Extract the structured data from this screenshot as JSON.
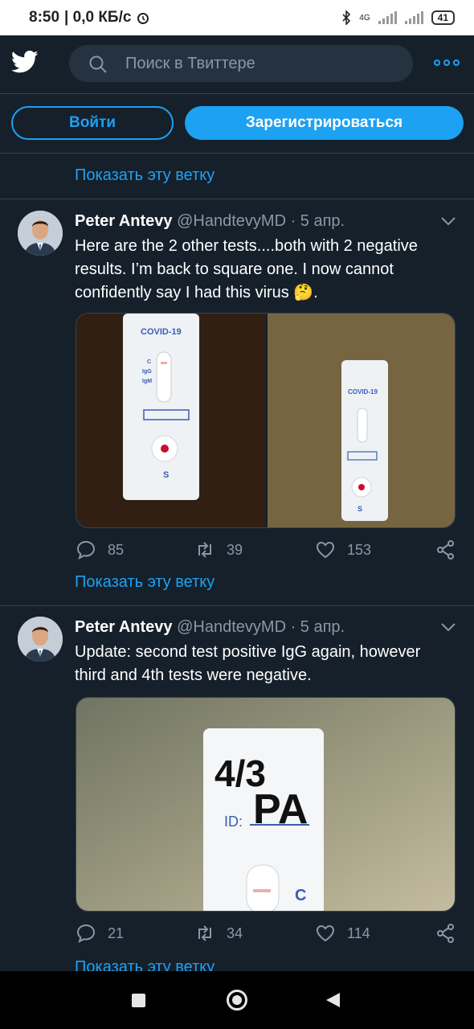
{
  "status_bar": {
    "time": "8:50",
    "speed": "| 0,0 КБ/с",
    "network": "4G",
    "battery": "41"
  },
  "header": {
    "logo_icon": "twitter-bird-icon",
    "search_placeholder": "Поиск в Твиттере",
    "more_icon": "more-dots-icon"
  },
  "auth": {
    "login_label": "Войти",
    "signup_label": "Зарегистрироваться"
  },
  "show_thread_label": "Показать эту ветку",
  "tweets": [
    {
      "name": "Peter Antevy",
      "handle": "@HandtevyMD",
      "sep": " · ",
      "date": "5 апр.",
      "text": "Here are the 2 other tests....both with 2 negative results. I’m back to square one. I now cannot confidently say I had this virus 🤔.",
      "media_labels": [
        "COVID-19",
        "C",
        "IgG",
        "IgM",
        "S",
        "COVID-19",
        "S"
      ],
      "replies": "85",
      "retweets": "39",
      "likes": "153"
    },
    {
      "name": "Peter Antevy",
      "handle": "@HandtevyMD",
      "sep": " · ",
      "date": "5 апр.",
      "text": "Update: second test positive IgG again, however third and 4th tests were negative.",
      "media_labels": [
        "4/3",
        "PA",
        "ID:",
        "C"
      ],
      "replies": "21",
      "retweets": "34",
      "likes": "114"
    }
  ],
  "colors": {
    "background": "#15202b",
    "accent": "#1da1f2",
    "muted": "#8899a6",
    "divider": "#38444d"
  }
}
